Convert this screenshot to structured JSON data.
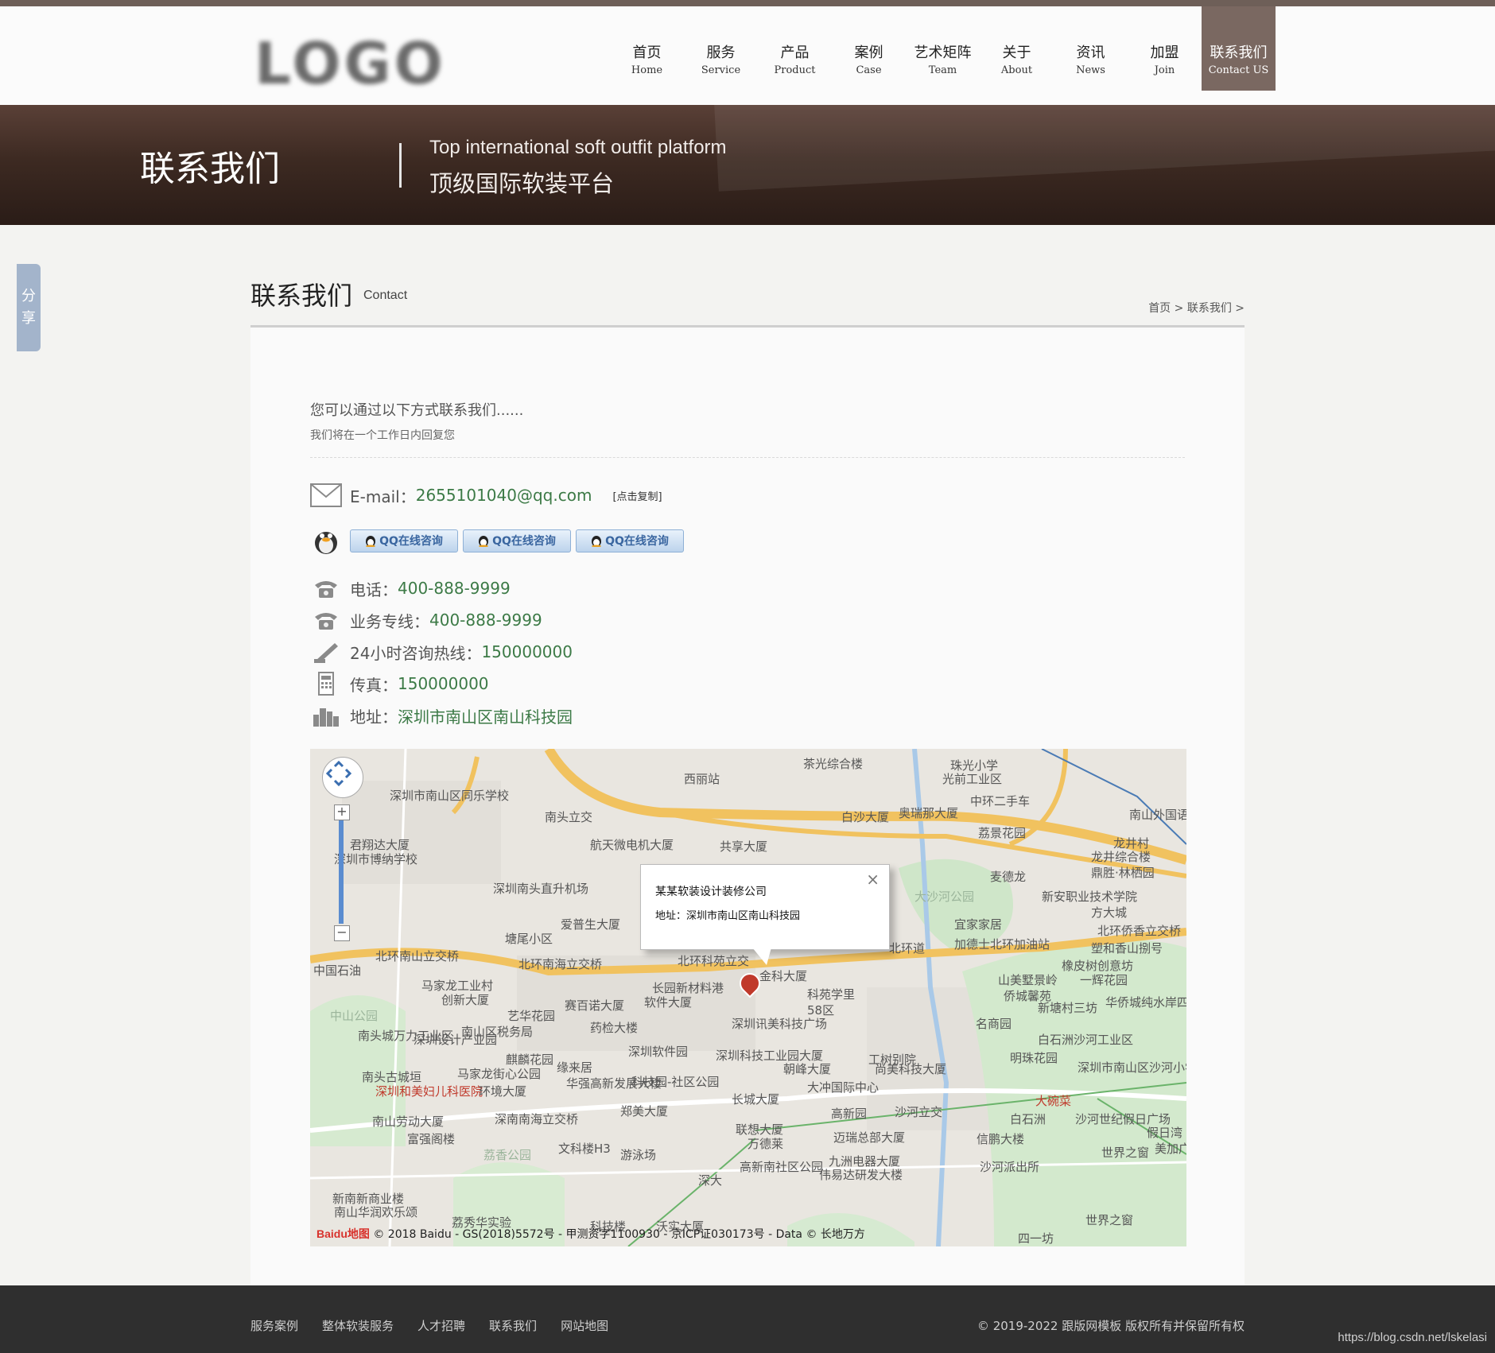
{
  "header": {
    "logo_text": "LOGO",
    "nav": [
      {
        "cn": "首页",
        "en": "Home"
      },
      {
        "cn": "服务",
        "en": "Service"
      },
      {
        "cn": "产品",
        "en": "Product"
      },
      {
        "cn": "案例",
        "en": "Case"
      },
      {
        "cn": "艺术矩阵",
        "en": "Team"
      },
      {
        "cn": "关于",
        "en": "About"
      },
      {
        "cn": "资讯",
        "en": "News"
      },
      {
        "cn": "加盟",
        "en": "Join"
      },
      {
        "cn": "联系我们",
        "en": "Contact US"
      }
    ],
    "active_index": 8
  },
  "banner": {
    "title": "联系我们",
    "subtitle_en": "Top international soft outfit platform",
    "subtitle_cn": "顶级国际软装平台"
  },
  "share": {
    "label_1": "分",
    "label_2": "享"
  },
  "section": {
    "title": "联系我们",
    "subtitle": "Contact",
    "breadcrumb": "首页 > 联系我们 >"
  },
  "intro": {
    "line1": "您可以通过以下方式联系我们......",
    "line2": "我们将在一个工作日内回复您"
  },
  "contact": {
    "email_label": "E-mail：",
    "email_value": "2655101040@qq.com",
    "copy_label": "[点击复制]",
    "qq_buttons": [
      "QQ在线咨询",
      "QQ在线咨询",
      "QQ在线咨询"
    ],
    "phone_label": "电话：",
    "phone_value": "400-888-9999",
    "biz_label": "业务专线：",
    "biz_value": "400-888-9999",
    "hotline_label": "24小时咨询热线：",
    "hotline_value": "150000000",
    "fax_label": "传真：",
    "fax_value": "150000000",
    "address_label": "地址：",
    "address_value": "深圳市南山区南山科技园"
  },
  "map": {
    "popup_title": "某某软装设计装修公司",
    "popup_address": "地址：深圳市南山区南山科技园",
    "copyright": "© 2018 Baidu - GS(2018)5572号 - 甲测资字1100930 - 京ICP证030173号 - Data © 长地万方",
    "baidu_logo": "Baidu地图",
    "labels": {
      "l1": "茶光综合楼",
      "l2": "珠光小学",
      "l3": "光前工业区",
      "l4": "西丽站",
      "l5": "深圳市南山区同乐学校",
      "l6": "南头立交",
      "l7": "航天微电机大厦",
      "l8": "共享大厦",
      "l9": "白沙大厦",
      "l10": "奥瑞那大厦",
      "l11": "中环二手车",
      "l12": "荔景花园",
      "l13": "麦德龙",
      "l14": "大沙河公园",
      "l15": "新安职业技术学院",
      "l16": "宜家家居",
      "l17": "北环侨香立交桥",
      "l18": "深圳南头直升机场",
      "l19": "爱普生大厦",
      "l20": "塘尾小区",
      "l21": "北环南山立交桥",
      "l22": "北环南海立交桥",
      "l23": "北环科苑立交",
      "l24": "金科大厦",
      "l25": "长园新材料港",
      "l26": "科苑学里",
      "l27": "58区",
      "l28": "马家龙工业村",
      "l29": "创新大厦",
      "l30": "艺华花园",
      "l31": "南山区税务局",
      "l32": "赛百诺大厦",
      "l33": "软件大厦",
      "l34": "深圳讯美科技广场",
      "l35": "药检大楼",
      "l36": "深圳软件园",
      "l37": "麒麟花园",
      "l38": "深圳科技工业园大厦",
      "l39": "朝峰大厦",
      "l40": "尚美科技大厦",
      "l41": "明珠花园",
      "l42": "深圳市南山区沙河小学",
      "l43": "南头古城垣",
      "l44": "深圳和美妇儿科医院",
      "l45": "马家龙街心公园",
      "l46": "华强高新发展大楼",
      "l47": "科技园-社区公园",
      "l48": "大冲国际中心",
      "l49": "长城大厦",
      "l50": "高新园",
      "l51": "沙河立交",
      "l52": "环境大厦",
      "l53": "深南南海立交桥",
      "l54": "郑美大厦",
      "l55": "联想大厦",
      "l56": "万德莱",
      "l57": "迈瑞总部大厦",
      "l58": "信鹏大楼",
      "l59": "沙河世纪假日广场",
      "l60": "南山劳动大厦",
      "l61": "富强阁楼",
      "l62": "荔香公园",
      "l63": "文科楼H3",
      "l64": "游泳场",
      "l65": "高新南社区公园",
      "l66": "九洲电器大厦",
      "l67": "伟易达研发大楼",
      "l68": "沙河派出所",
      "l69": "世界之窗",
      "l70": "白石洲",
      "l71": "深圳市博纳学校",
      "l72": "君翔达大厦",
      "l73": "中国石油",
      "l74": "中山公园",
      "l75": "南头城万力工业区",
      "l76": "新塘村三坊",
      "l77": "名商园",
      "l78": "华侨城纯水岸四期",
      "l79": "山美墅景岭",
      "l80": "塑和香山捌号",
      "l81": "橡皮树创意坊",
      "l82": "加德士北环加油站",
      "l83": "方大城",
      "l84": "龙井村",
      "l85": "南山外国语学校",
      "l86": "深圳设计产业园",
      "l87": "北环道",
      "l88": "缘来居",
      "l89": "工树别院",
      "l90": "龙井综合楼",
      "l91": "鼎胜·林栖园",
      "l92": "侨城馨苑",
      "l93": "一辉花园",
      "l94": "白石洲沙河工业区",
      "l95": "大碗菜",
      "l96": "深大",
      "l97": "新南新商业楼",
      "l98": "南山华润欢乐颂",
      "l99": "荔秀华实验",
      "l100": "科技楼",
      "l101": "沃实大厦",
      "l102": "假日湾",
      "l103": "美加广",
      "l104": "世界之窗",
      "l105": "四一坊"
    }
  },
  "footer": {
    "links": [
      "服务案例",
      "整体软装服务",
      "人才招聘",
      "联系我们",
      "网站地图"
    ],
    "copyright": "© 2019-2022 跟版网模板 版权所有并保留所有权"
  },
  "watermark": "https://blog.csdn.net/lskelasi"
}
